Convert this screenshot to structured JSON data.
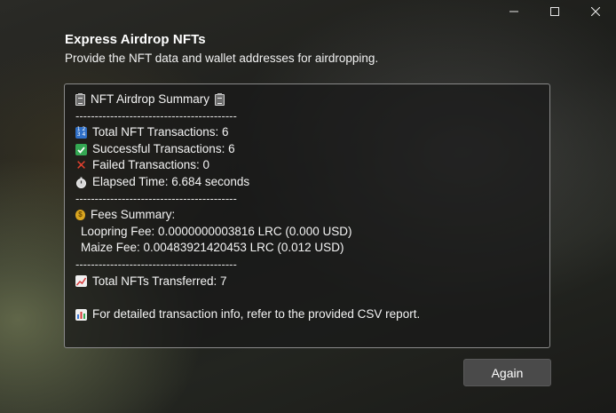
{
  "window": {
    "controls": [
      "minimize-icon",
      "maximize-icon",
      "close-icon"
    ]
  },
  "header": {
    "title": "Express Airdrop NFTs",
    "subtitle": "Provide the NFT data and wallet addresses for airdropping."
  },
  "summary": {
    "heading": "NFT Airdrop Summary",
    "separator": "------------------------------------------",
    "total_nft_transactions": "Total NFT Transactions: 6",
    "successful_transactions": "Successful Transactions: 6",
    "failed_transactions": "Failed Transactions: 0",
    "elapsed_time": "Elapsed Time: 6.684 seconds",
    "fees_heading": "Fees Summary:",
    "loopring_fee": "Loopring Fee: 0.0000000003816 LRC (0.000 USD)",
    "maize_fee": "Maize Fee: 0.00483921420453 LRC (0.012 USD)",
    "total_transferred": "Total NFTs Transferred: 7",
    "csv_note": "For detailed transaction info, refer to the provided CSV report."
  },
  "actions": {
    "again_label": "Again"
  },
  "icons": {
    "heading": "clipboard-icon",
    "total": "input-numbers-icon",
    "success": "check-mark-icon",
    "failed": "cross-mark-icon",
    "elapsed": "stopwatch-icon",
    "fees": "money-bag-icon",
    "transferred": "chart-increasing-icon",
    "csv": "bar-chart-icon"
  }
}
